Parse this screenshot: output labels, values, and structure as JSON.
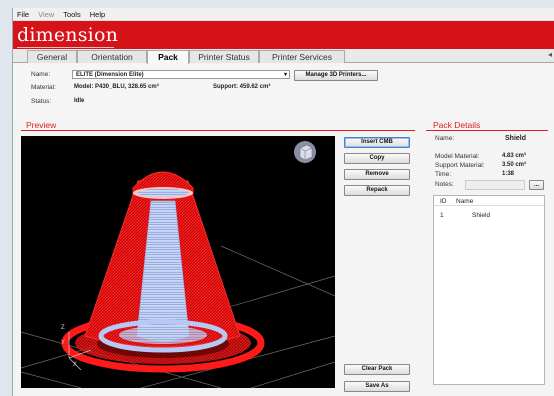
{
  "menu": [
    "File",
    "View",
    "Tools",
    "Help"
  ],
  "brand": "dimension",
  "tabs": [
    {
      "label": "General"
    },
    {
      "label": "Orientation"
    },
    {
      "label": "Pack"
    },
    {
      "label": "Printer Status"
    },
    {
      "label": "Printer Services"
    }
  ],
  "active_tab": "Pack",
  "printer": {
    "name_label": "Name:",
    "name_value": "ELITE  (Dimension Elite)",
    "manage_button": "Manage 3D Printers...",
    "material_label": "Material:",
    "model_material": "Model: P430_BLU, 328.65 cm³",
    "support_material": "Support: 459.62 cm³",
    "status_label": "Status:",
    "status_value": "Idle"
  },
  "preview": {
    "title": "Preview",
    "axis_labels": [
      "Z",
      "Y",
      "X"
    ]
  },
  "actions": {
    "insert": "Insert CMB",
    "copy": "Copy",
    "remove": "Remove",
    "repack": "Repack",
    "clear_pack": "Clear Pack",
    "save_as": "Save As"
  },
  "pack_details": {
    "title": "Pack Details",
    "name_label": "Name:",
    "name_value": "Shield",
    "model_material_label": "Model Material:",
    "model_material_value": "4.83 cm³",
    "support_material_label": "Support Material:",
    "support_material_value": "3.50 cm³",
    "time_label": "Time:",
    "time_value": "1:38",
    "notes_label": "Notes:",
    "notes_button": "...",
    "table_headers": [
      "ID",
      "Name"
    ],
    "rows": [
      {
        "id": "1",
        "name": "Shield"
      }
    ]
  },
  "colors": {
    "brand_red": "#d7131a",
    "model_red": "#ff1a1a",
    "support_blue": "#a9bff2",
    "viewport_bg": "#000000"
  }
}
